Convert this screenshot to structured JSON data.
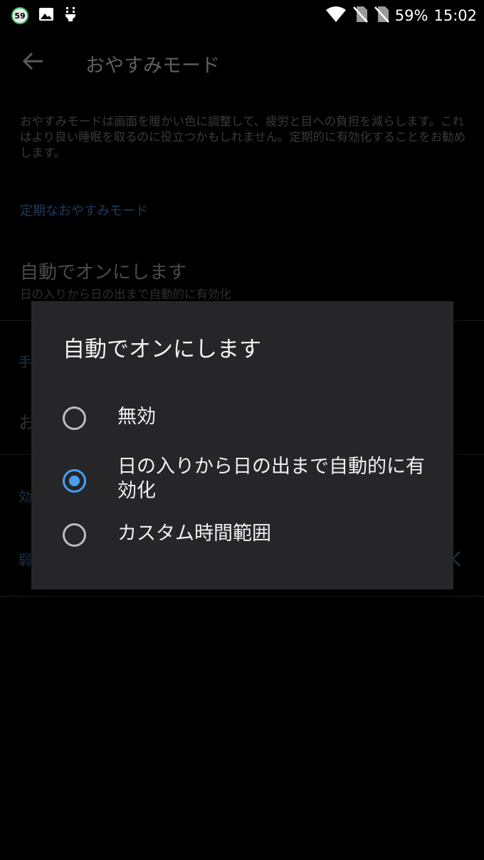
{
  "status_bar": {
    "notification_badge": "59",
    "icons_left": [
      "battery-circle-icon",
      "image-icon",
      "usb-debug-icon"
    ],
    "icons_right": [
      "wifi-icon",
      "sim-no-signal-icon",
      "sim-no-signal-icon"
    ],
    "battery_percent": "59%",
    "time": "15:02"
  },
  "page": {
    "title": "おやすみモード",
    "description": "おやすみモードは画面を暖かい色に調整して、疲労と目への負担を減らします。これはより良い睡眠を取るのに役立つかもしれません。定期的に有効化することをお勧めします。",
    "section_scheduled": "定期なおやすみモード",
    "auto_on_title": "自動でオンにします",
    "auto_on_summary": "日の入りから日の出まで自動的に有効化",
    "peek_texts": [
      "手",
      "お",
      "効",
      "弱"
    ]
  },
  "dialog": {
    "title": "自動でオンにします",
    "options": [
      {
        "label": "無効",
        "checked": false
      },
      {
        "label": "日の入りから日の出まで自動的に有効化",
        "checked": true
      },
      {
        "label": "カスタム時間範囲",
        "checked": false
      }
    ]
  },
  "colors": {
    "accent": "#4a9ef2",
    "dialog_bg": "#262628",
    "background": "#000000"
  }
}
